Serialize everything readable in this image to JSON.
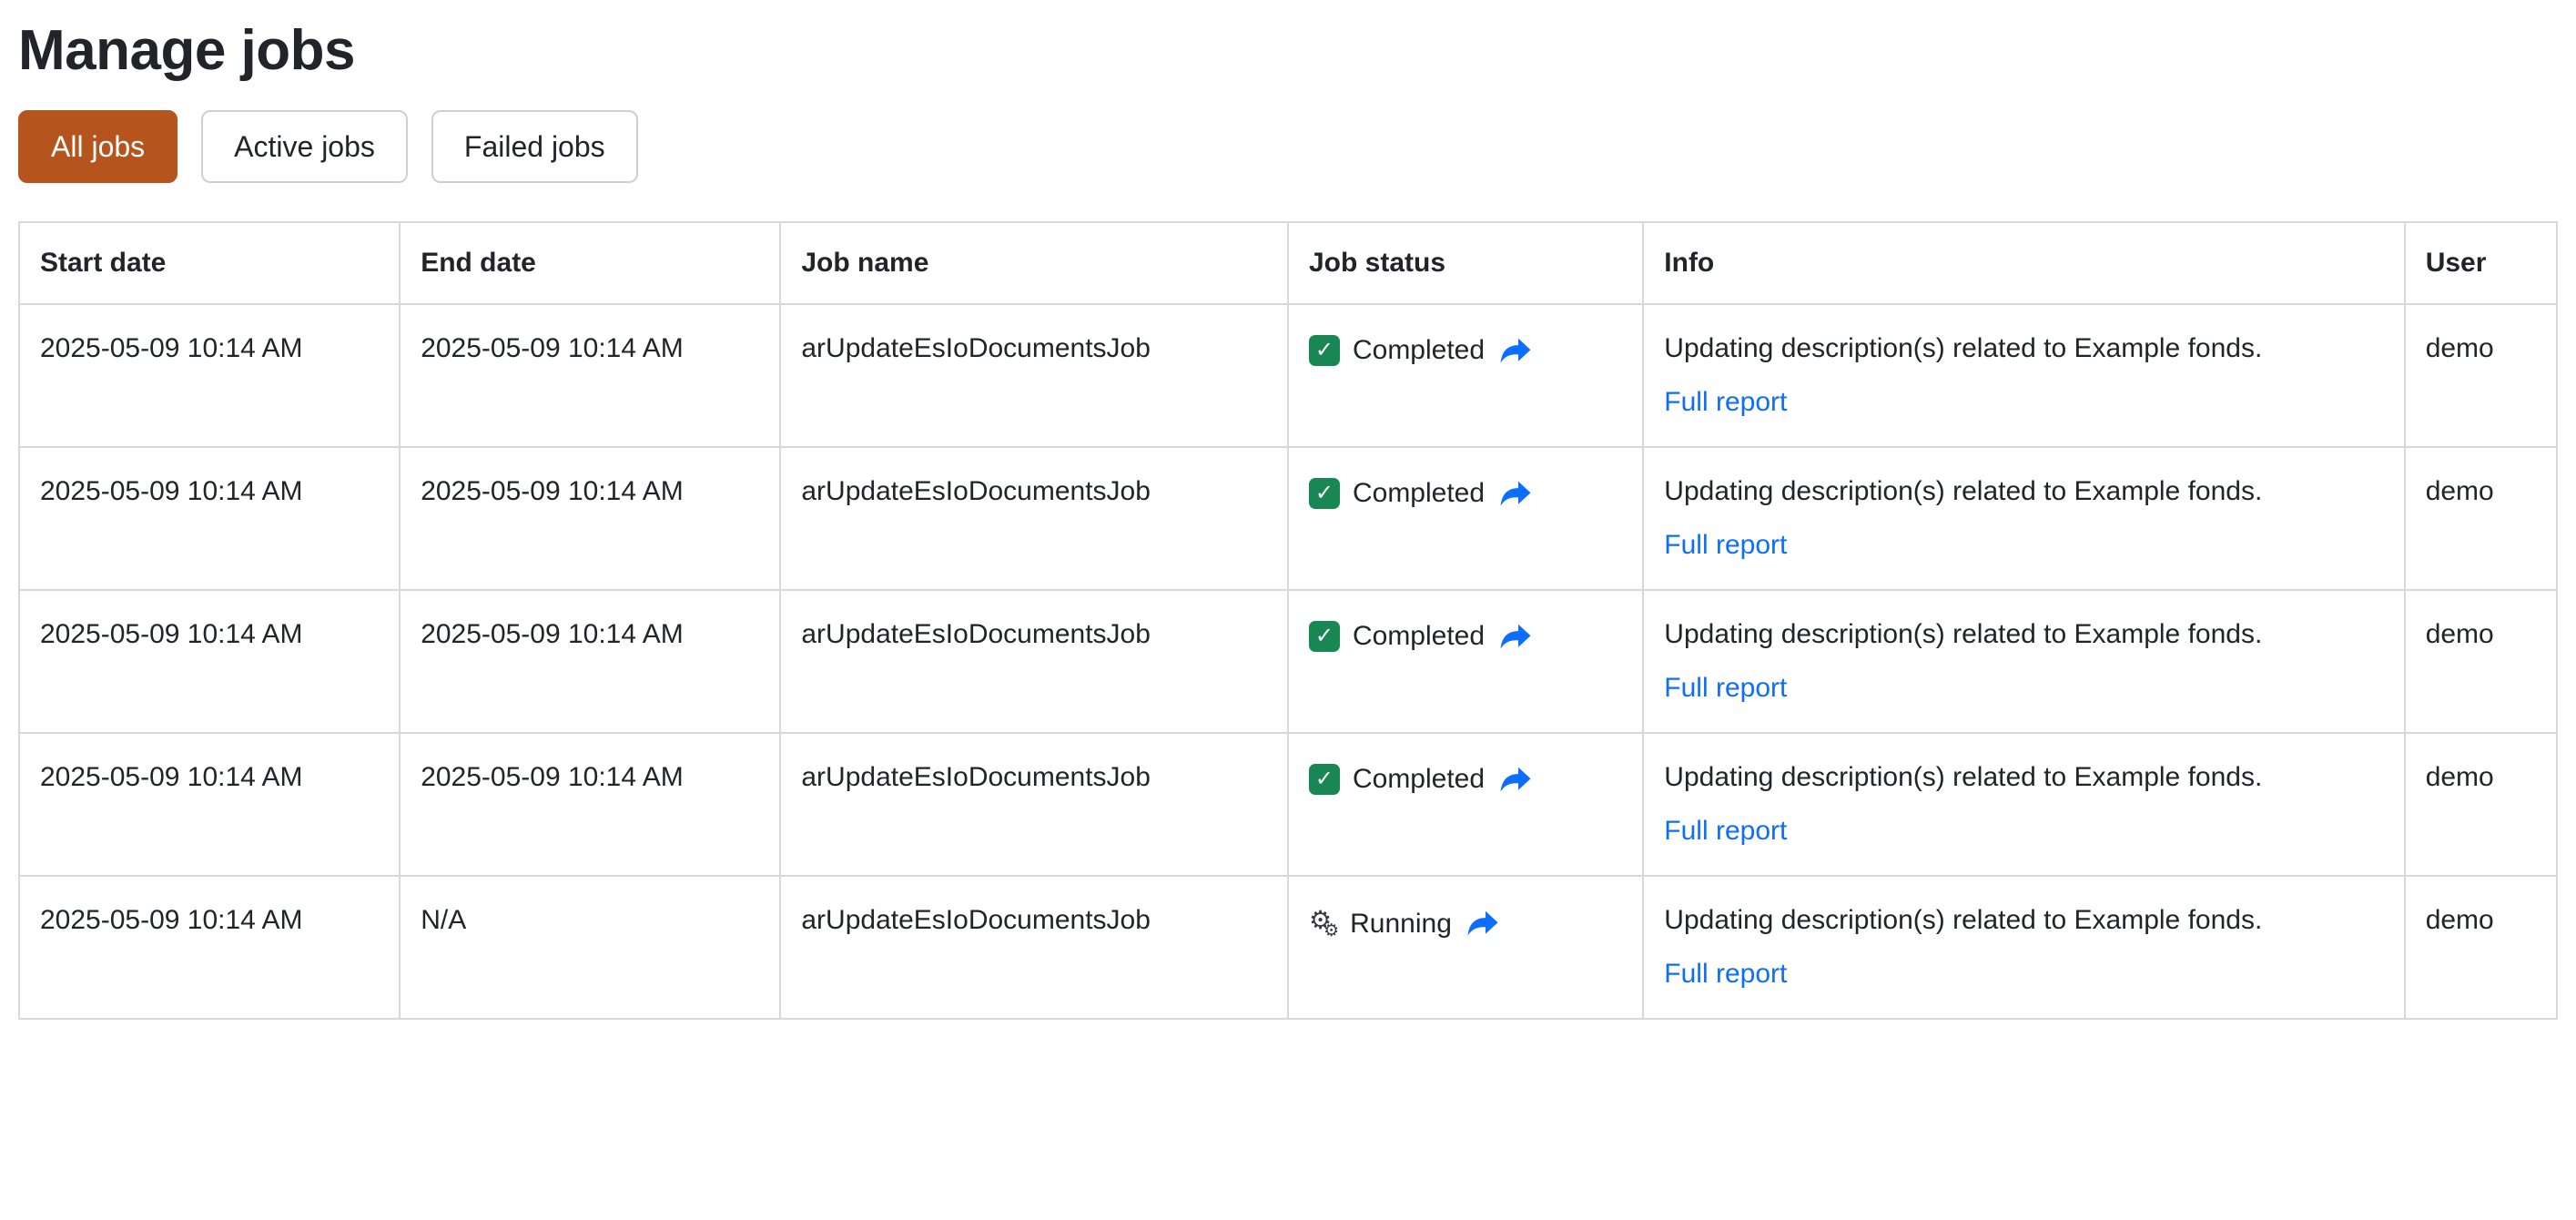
{
  "page": {
    "title": "Manage jobs"
  },
  "filters": [
    {
      "label": "All jobs",
      "active": true
    },
    {
      "label": "Active jobs",
      "active": false
    },
    {
      "label": "Failed jobs",
      "active": false
    }
  ],
  "table": {
    "headers": [
      "Start date",
      "End date",
      "Job name",
      "Job status",
      "Info",
      "User"
    ],
    "rows": [
      {
        "start": "2025-05-09 10:14 AM",
        "end": "2025-05-09 10:14 AM",
        "name": "arUpdateEsIoDocumentsJob",
        "status": "Completed",
        "status_kind": "completed",
        "info": "Updating description(s) related to Example fonds.",
        "report": "Full report",
        "user": "demo"
      },
      {
        "start": "2025-05-09 10:14 AM",
        "end": "2025-05-09 10:14 AM",
        "name": "arUpdateEsIoDocumentsJob",
        "status": "Completed",
        "status_kind": "completed",
        "info": "Updating description(s) related to Example fonds.",
        "report": "Full report",
        "user": "demo"
      },
      {
        "start": "2025-05-09 10:14 AM",
        "end": "2025-05-09 10:14 AM",
        "name": "arUpdateEsIoDocumentsJob",
        "status": "Completed",
        "status_kind": "completed",
        "info": "Updating description(s) related to Example fonds.",
        "report": "Full report",
        "user": "demo"
      },
      {
        "start": "2025-05-09 10:14 AM",
        "end": "2025-05-09 10:14 AM",
        "name": "arUpdateEsIoDocumentsJob",
        "status": "Completed",
        "status_kind": "completed",
        "info": "Updating description(s) related to Example fonds.",
        "report": "Full report",
        "user": "demo"
      },
      {
        "start": "2025-05-09 10:14 AM",
        "end": "N/A",
        "name": "arUpdateEsIoDocumentsJob",
        "status": "Running",
        "status_kind": "running",
        "info": "Updating description(s) related to Example fonds.",
        "report": "Full report",
        "user": "demo"
      }
    ]
  },
  "icons": {
    "completed": "check-square-icon",
    "running": "gears-icon",
    "status_link": "forward-arrow-icon",
    "check_glyph": "✓",
    "gear_glyph": "⚙"
  },
  "colors": {
    "accent": "#b5541c",
    "link": "#0d6efd",
    "success": "#198754"
  }
}
